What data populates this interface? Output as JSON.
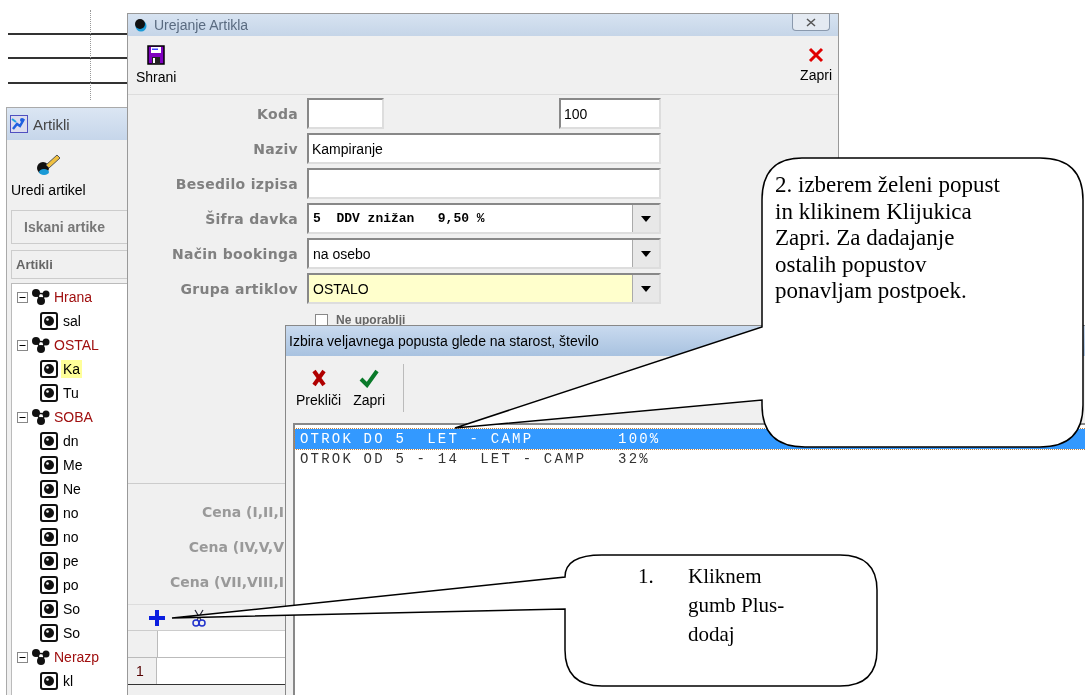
{
  "artikli_window": {
    "title": "Artikli",
    "toolbar": [
      {
        "label": "Uredi artikel"
      }
    ],
    "search_label": "Iskani artike",
    "list_header": "Artikli",
    "tree": [
      {
        "label": "Hrana",
        "expanded": true,
        "children": [
          {
            "label": "sal",
            "selected": false
          }
        ]
      },
      {
        "label": "OSTAL",
        "expanded": true,
        "children": [
          {
            "label": "Ka",
            "selected": true
          },
          {
            "label": "Tu",
            "selected": false
          }
        ]
      },
      {
        "label": "SOBA",
        "expanded": true,
        "children": [
          {
            "label": "dn",
            "selected": false
          },
          {
            "label": "Me",
            "selected": false
          },
          {
            "label": "Ne",
            "selected": false
          },
          {
            "label": "no",
            "selected": false
          },
          {
            "label": "no",
            "selected": false
          },
          {
            "label": "pe",
            "selected": false
          },
          {
            "label": "po",
            "selected": false
          },
          {
            "label": "So",
            "selected": false
          },
          {
            "label": "So",
            "selected": false
          }
        ]
      },
      {
        "label": "Nerazp",
        "expanded": true,
        "children": [
          {
            "label": "kl",
            "selected": false
          }
        ]
      }
    ]
  },
  "edit_window": {
    "title": "Urejanje Artikla",
    "toolbar": [
      {
        "kind": "save",
        "label": "Shrani"
      },
      {
        "kind": "close",
        "label": "Zapri"
      }
    ],
    "fields": [
      {
        "kind": "code",
        "label": "Koda",
        "second_value": "100"
      },
      {
        "kind": "text",
        "label": "Naziv",
        "value": "Kampiranje"
      },
      {
        "kind": "text",
        "label": "Besedilo izpisa"
      },
      {
        "kind": "dropdown",
        "label": "Šifra davka",
        "value": "5  DDV znižan   9,50 %",
        "monospace": true,
        "highlighted": false
      },
      {
        "kind": "dropdown",
        "label": "Način bookinga",
        "value": "na osebo",
        "monospace": false,
        "highlighted": false
      },
      {
        "kind": "dropdown",
        "label": "Grupa artiklov",
        "value": "OSTALO",
        "monospace": false,
        "highlighted": true
      }
    ],
    "checkbox": {
      "label": "Ne uporablji",
      "checked": false
    },
    "price_labels": [
      "Cena (I,II,I",
      "Cena (IV,V,V",
      "Cena (VII,VIII,I"
    ],
    "grid": {
      "rows": [
        {
          "number": "1"
        }
      ]
    }
  },
  "dialog": {
    "title": "Izbira veljavnega popusta glede na starost, število",
    "toolbar": [
      {
        "kind": "cancel",
        "label": "Prekliči"
      },
      {
        "kind": "confirm",
        "label": "Zapri"
      }
    ],
    "items": [
      {
        "text": "OTROK DO 5  LET - CAMP        100%",
        "selected": true
      },
      {
        "text": "OTROK OD 5 - 14  LET - CAMP   32%",
        "selected": false
      }
    ]
  },
  "callouts": [
    {
      "lines": [
        "2. izberem želeni popust",
        "in klikinem Klijukica",
        "Zapri. Za dadajanje",
        "ostalih popustov",
        "ponavljam postpoek."
      ]
    },
    {
      "number": "1.",
      "lines": [
        "Kliknem",
        "gumb Plus-",
        "dodaj"
      ]
    }
  ]
}
